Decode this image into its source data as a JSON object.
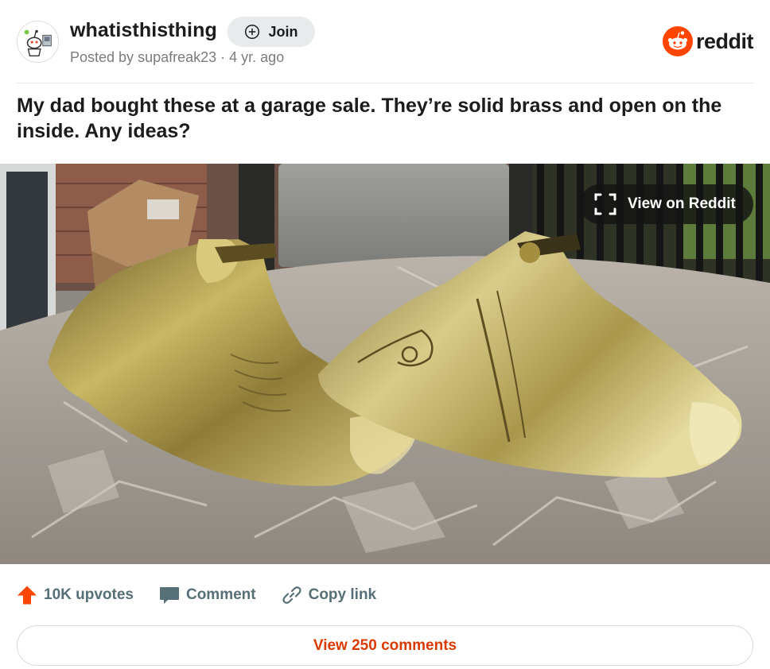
{
  "header": {
    "subreddit": "whatisthisthing",
    "join_label": "Join",
    "posted_by_prefix": "Posted by",
    "author": "supafreak23",
    "age": "4 yr. ago",
    "brand": "reddit"
  },
  "post": {
    "title": "My dad bought these at a garage sale. They’re solid brass and open on the inside. Any ideas?"
  },
  "media": {
    "view_on_label": "View on Reddit"
  },
  "actions": {
    "upvotes": "10K upvotes",
    "comment": "Comment",
    "copy_link": "Copy link"
  },
  "footer": {
    "view_comments": "View 250 comments"
  },
  "colors": {
    "brand_orange": "#ff4500",
    "link_orange": "#d93a00",
    "action_gray": "#576f76",
    "join_bg": "#e9eaeb"
  },
  "icons": {
    "avatar": "snoo-avatar-icon",
    "join": "plus-circle-icon",
    "brand": "reddit-logo-icon",
    "expand": "expand-icon",
    "upvote": "upvote-arrow-icon",
    "comment": "comment-bubble-icon",
    "link": "link-icon"
  }
}
